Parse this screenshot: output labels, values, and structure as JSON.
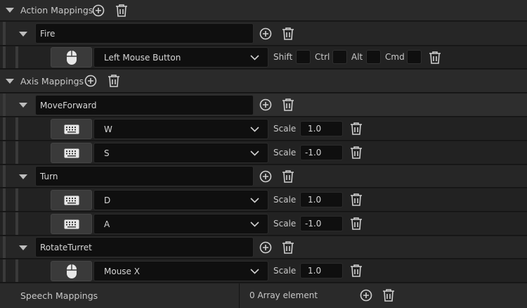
{
  "action_mappings": {
    "title": "Action Mappings",
    "mappings": [
      {
        "name": "Fire",
        "keys": [
          {
            "icon": "mouse-icon",
            "key": "Left Mouse Button",
            "modifiers": {
              "shift": "Shift",
              "ctrl": "Ctrl",
              "alt": "Alt",
              "cmd": "Cmd"
            }
          }
        ]
      }
    ]
  },
  "axis_mappings": {
    "title": "Axis Mappings",
    "scale_label": "Scale",
    "mappings": [
      {
        "name": "MoveForward",
        "keys": [
          {
            "icon": "keyboard-icon",
            "key": "W",
            "scale": "1.0"
          },
          {
            "icon": "keyboard-icon",
            "key": "S",
            "scale": "-1.0"
          }
        ]
      },
      {
        "name": "Turn",
        "keys": [
          {
            "icon": "keyboard-icon",
            "key": "D",
            "scale": "1.0"
          },
          {
            "icon": "keyboard-icon",
            "key": "A",
            "scale": "-1.0"
          }
        ]
      },
      {
        "name": "RotateTurret",
        "keys": [
          {
            "icon": "mouse-icon",
            "key": "Mouse X",
            "scale": "1.0"
          }
        ]
      }
    ]
  },
  "speech_mappings": {
    "title": "Speech Mappings",
    "count_text": "0 Array element"
  },
  "colors": {
    "panel_bg": "#1a1a1a",
    "row_bg": "#262626",
    "highlight_row_bg": "#2e2e2e",
    "field_bg": "#0f0f0f",
    "text": "#c8c8c8",
    "icon": "#bdbdbd"
  }
}
